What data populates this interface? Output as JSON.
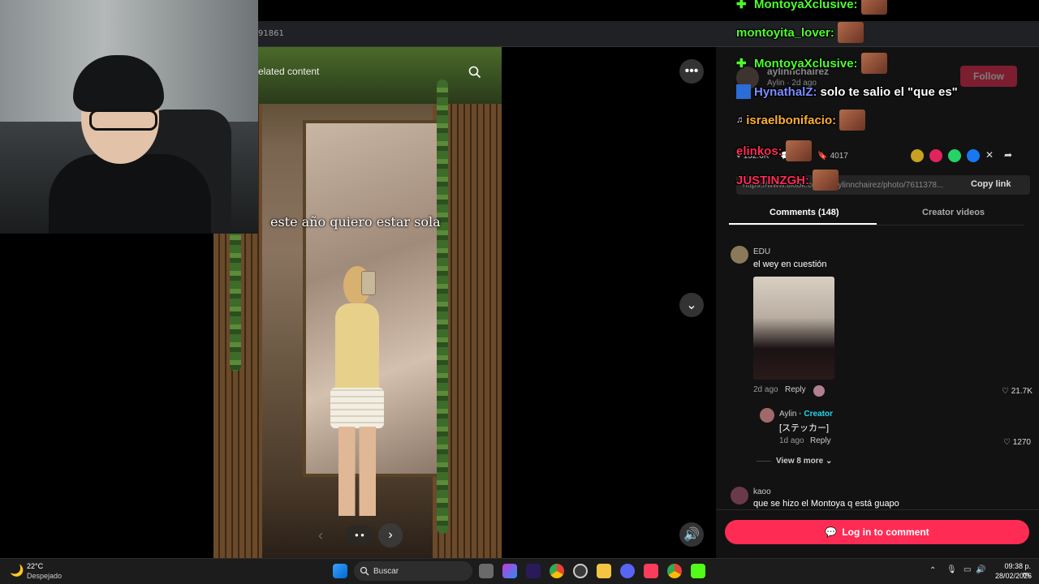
{
  "browser": {
    "url_fragment": "91861"
  },
  "viewer": {
    "related_label": "elated content",
    "caption": "este año quiero estar sola",
    "more_icon": "more-dots-icon",
    "chevron_icon": "chevron-down-icon",
    "volume_icon": "speaker-icon",
    "carousel_prev": "‹",
    "carousel_next": "›"
  },
  "chat": [
    {
      "user": "MontoyaXclusive:",
      "color": "#4cff2a"
    },
    {
      "user": "montoyita_lover:",
      "color": "#4cff2a"
    },
    {
      "user": "MontoyaXclusive:",
      "color": "#4cff2a"
    },
    {
      "user": "HynathalZ:",
      "color": "#7b8cff",
      "message": "solo te salio el \"que es\""
    },
    {
      "user": "israelbonifacio:",
      "color": "#ffb02a"
    },
    {
      "user": "elinkos:",
      "color": "#ff2a55"
    },
    {
      "user": "JUSTINZGH:",
      "color": "#ff2a55"
    }
  ],
  "post": {
    "author_handle": "aylinnchairez",
    "author_name": "Aylin",
    "posted": "2d ago",
    "follow_label": "Follow",
    "likes": "132.6K",
    "comments": "148",
    "saves": "4017",
    "link": "https://www.tiktok.com/@aylinnchairez/photo/7611378...",
    "copy_label": "Copy link"
  },
  "tabs": {
    "comments": "Comments (148)",
    "creator": "Creator videos"
  },
  "comments": [
    {
      "name": "EDU",
      "text": "el wey en cuestión",
      "time": "2d ago",
      "reply": "Reply",
      "likes": "21.7K"
    },
    {
      "name": "Aylin",
      "creator_tag": "· Creator",
      "text": "[ステッカー]",
      "time": "1d ago",
      "reply": "Reply",
      "likes": "1270"
    },
    {
      "view_more": "View 8 more"
    },
    {
      "name": "kaoo",
      "text": "que se hizo el Montoya q está guapo"
    }
  ],
  "login_label": "Log in to comment",
  "taskbar": {
    "temp": "22°C",
    "weather": "Despejado",
    "search_placeholder": "Buscar",
    "time": "09:38 p. m.",
    "date": "28/02/2026"
  }
}
